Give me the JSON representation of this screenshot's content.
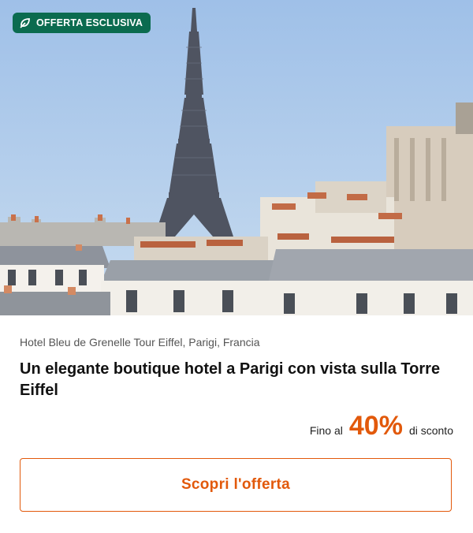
{
  "badge": {
    "icon": "sparkle-leaf-icon",
    "label": "OFFERTA ESCLUSIVA",
    "color": "#0b6b4f"
  },
  "hero": {
    "icon": "eiffel-tower-photo"
  },
  "location": "Hotel Bleu de Grenelle Tour Eiffel, Parigi, Francia",
  "title": "Un elegante boutique hotel a Parigi con vista sulla Torre Eiffel",
  "discount": {
    "prefix": "Fino al",
    "value": "40%",
    "suffix": "di sconto",
    "accent": "#e2590b"
  },
  "cta": {
    "label": "Scopri l'offerta"
  }
}
